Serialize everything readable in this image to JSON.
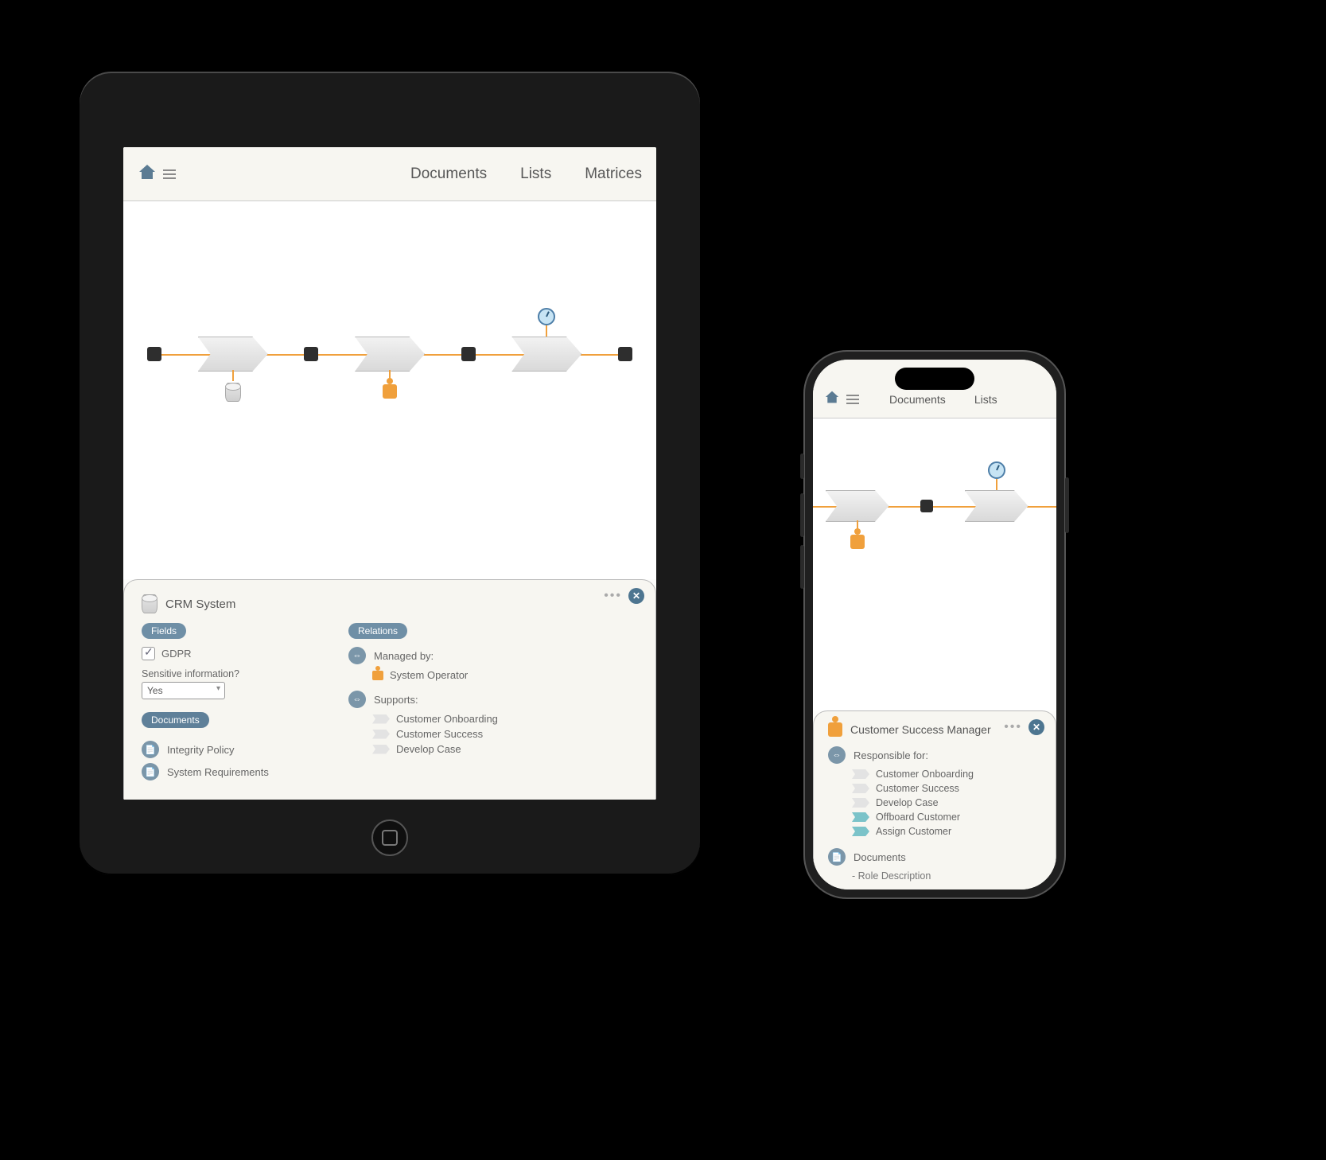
{
  "nav": {
    "documents": "Documents",
    "lists": "Lists",
    "matrices": "Matrices"
  },
  "tablet_panel": {
    "title": "CRM System",
    "fields_label": "Fields",
    "gdpr_label": "GDPR",
    "sensitive_label": "Sensitive information?",
    "sensitive_value": "Yes",
    "documents_label": "Documents",
    "doc1": "Integrity Policy",
    "doc2": "System Requirements",
    "relations_label": "Relations",
    "managed_by_label": "Managed by:",
    "managed_by_value": "System Operator",
    "supports_label": "Supports:",
    "support1": "Customer Onboarding",
    "support2": "Customer Success",
    "support3": "Develop Case"
  },
  "phone_panel": {
    "title": "Customer Success Manager",
    "responsible_label": "Responsible for:",
    "r1": "Customer Onboarding",
    "r2": "Customer Success",
    "r3": "Develop Case",
    "r4": "Offboard Customer",
    "r5": "Assign Customer",
    "documents_label": "Documents",
    "doc1": "- Role Description"
  }
}
